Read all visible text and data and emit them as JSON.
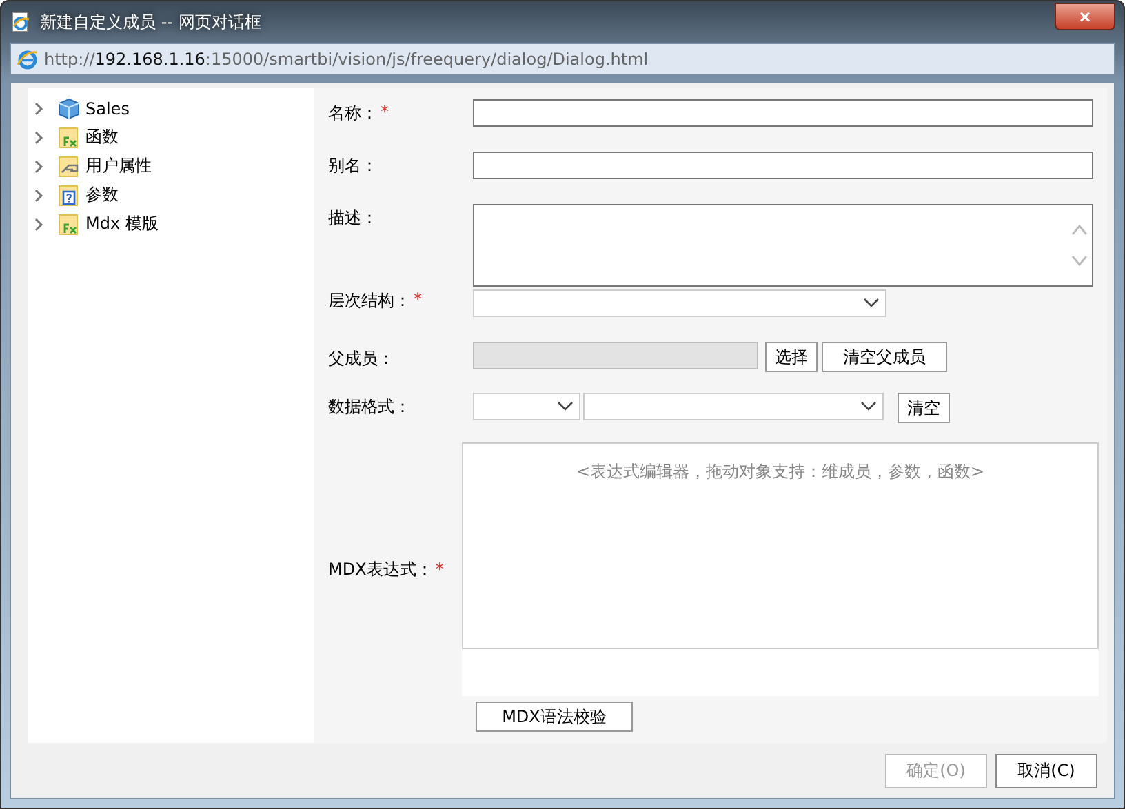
{
  "window": {
    "title": "新建自定义成员 -- 网页对话框",
    "close": "×"
  },
  "address": {
    "url": "http://**192.168.1.16**:15000/smartbi/vision/js/freequery/dialog/Dialog.html"
  },
  "tree": [
    {
      "label": "Sales",
      "kind": "cube",
      "expanded": false
    },
    {
      "label": "函数",
      "kind": "function",
      "expanded": false
    },
    {
      "label": "用户属性",
      "kind": "user",
      "expanded": false
    },
    {
      "label": "参数",
      "kind": "param",
      "expanded": false
    },
    {
      "label": "Mdx 模版",
      "kind": "function",
      "expanded": false
    }
  ],
  "form": [
    {
      "kind": "text",
      "label": "名称：",
      "required_mark": "*"
    },
    {
      "kind": "text",
      "label": "别名："
    },
    {
      "kind": "textarea",
      "label": "描述："
    },
    {
      "kind": "select",
      "label": "层次结构：",
      "required_mark": "*"
    },
    {
      "kind": "parent",
      "label": "父成员：",
      "buttons": [
        "选择",
        "清空父成员"
      ]
    },
    {
      "kind": "format",
      "label": "数据格式：",
      "buttons": [
        "清空"
      ]
    },
    {
      "kind": "expression",
      "label": "MDX表达式：",
      "required_mark": "*",
      "placeholder": "<表达式编辑器，拖动对象支持：维成员，参数，函数>",
      "buttons": [
        "MDX语法校验"
      ]
    }
  ],
  "footer": [
    {
      "label": "确定(O)",
      "disabled": true
    },
    {
      "label": "取消(C)",
      "disabled": false
    }
  ]
}
